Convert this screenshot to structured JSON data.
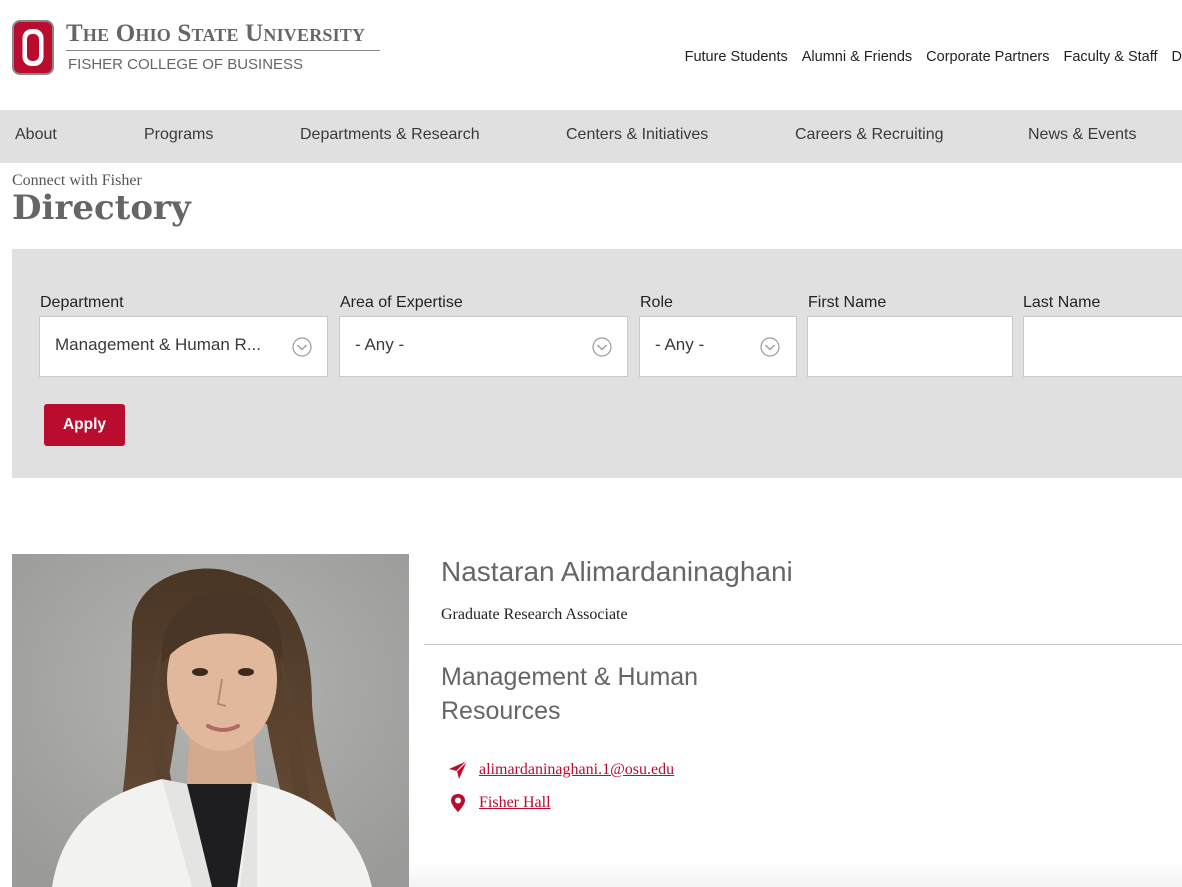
{
  "brand": {
    "university": "The Ohio State University",
    "college": "FISHER COLLEGE OF BUSINESS",
    "accent_color": "#ba0c2f",
    "logo_icon": "block-o-icon"
  },
  "utility_nav": [
    "Future Students",
    "Alumni & Friends",
    "Corporate Partners",
    "Faculty & Staff",
    "D"
  ],
  "main_nav": [
    "About",
    "Programs",
    "Departments & Research",
    "Centers & Initiatives",
    "Careers & Recruiting",
    "News & Events"
  ],
  "page": {
    "eyebrow": "Connect with Fisher",
    "title": "Directory"
  },
  "filters": {
    "department": {
      "label": "Department",
      "value": "Management & Human R..."
    },
    "expertise": {
      "label": "Area of Expertise",
      "value": "- Any -"
    },
    "role": {
      "label": "Role",
      "value": "- Any -"
    },
    "first_name": {
      "label": "First Name",
      "value": ""
    },
    "last_name": {
      "label": "Last Name",
      "value": ""
    },
    "apply_label": "Apply",
    "chevron_icon": "chevron-down-circle-icon"
  },
  "profile": {
    "name": "Nastaran Alimardaninaghani",
    "title": "Graduate Research Associate",
    "department": "Management & Human Resources",
    "email": "alimardaninaghani.1@osu.edu",
    "location": "Fisher Hall",
    "email_icon": "paper-plane-icon",
    "location_icon": "map-pin-icon"
  }
}
